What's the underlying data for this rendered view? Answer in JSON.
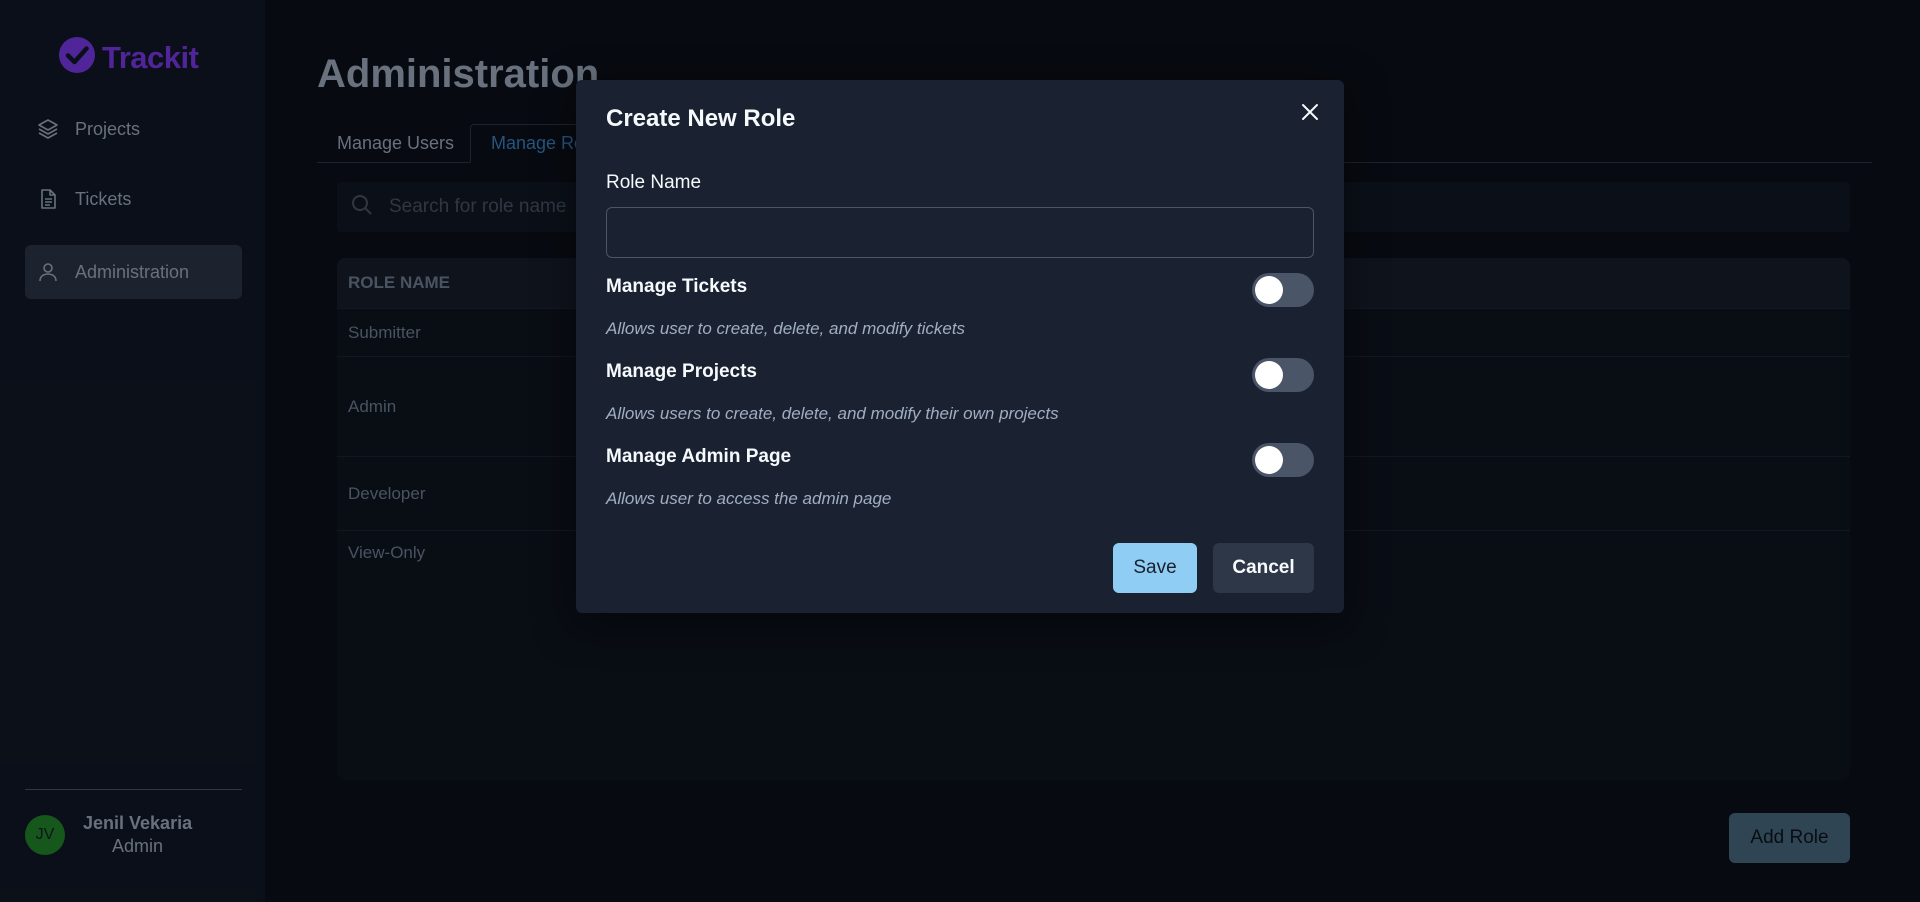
{
  "brand": {
    "name": "Trackit",
    "color": "#7c3aed"
  },
  "sidebar": {
    "items": [
      {
        "label": "Projects",
        "icon": "layers-icon"
      },
      {
        "label": "Tickets",
        "icon": "document-icon"
      },
      {
        "label": "Administration",
        "icon": "user-icon",
        "active": true
      }
    ],
    "user": {
      "initials": "JV",
      "name": "Jenil Vekaria",
      "role": "Admin"
    }
  },
  "main": {
    "title": "Administration",
    "tabs": [
      {
        "label": "Manage Users"
      },
      {
        "label": "Manage Ro",
        "active": true
      }
    ],
    "search": {
      "placeholder": "Search for role name"
    },
    "table": {
      "header": "ROLE NAME",
      "rows": [
        "Submitter",
        "Admin",
        "Developer",
        "View-Only"
      ]
    },
    "add_role_label": "Add Role"
  },
  "modal": {
    "title": "Create New Role",
    "role_name_label": "Role Name",
    "role_name_value": "",
    "permissions": [
      {
        "title": "Manage Tickets",
        "description": "Allows user to create, delete, and modify tickets",
        "enabled": false
      },
      {
        "title": "Manage Projects",
        "description": "Allows users to create, delete, and modify their own projects",
        "enabled": false
      },
      {
        "title": "Manage Admin Page",
        "description": "Allows user to access the admin page",
        "enabled": false
      }
    ],
    "save_label": "Save",
    "cancel_label": "Cancel"
  },
  "colors": {
    "accent": "#90cdf4",
    "active_tab": "#3b82c4",
    "avatar": "#22862a"
  }
}
